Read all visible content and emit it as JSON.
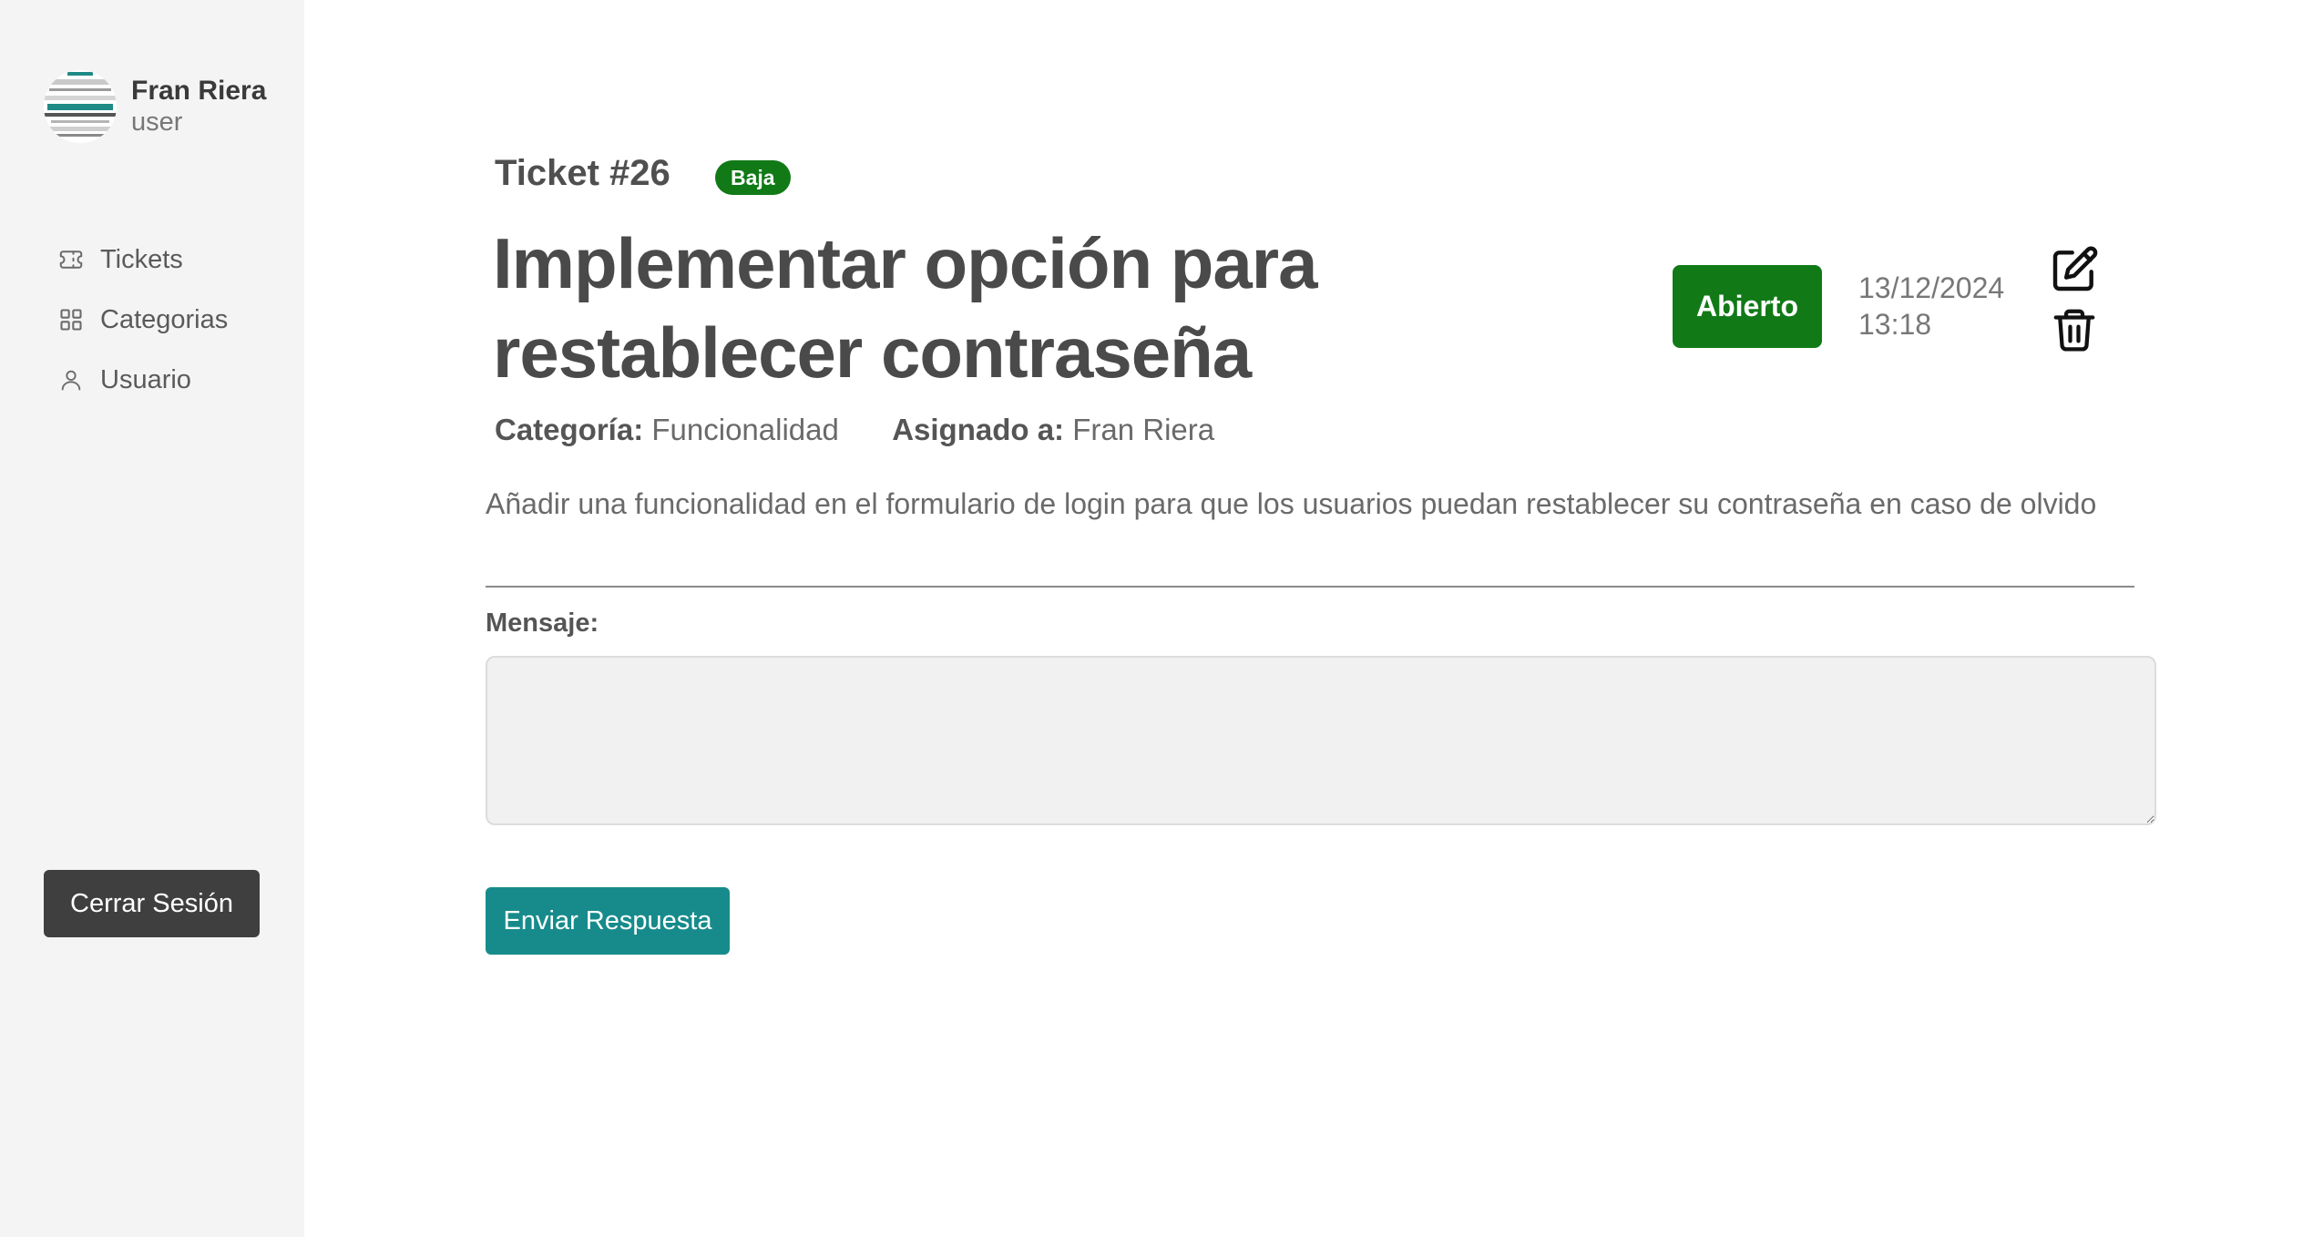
{
  "sidebar": {
    "user": {
      "name": "Fran Riera",
      "role": "user",
      "avatar_icon": "avatar-image"
    },
    "nav": [
      {
        "label": "Tickets",
        "icon": "ticket-icon"
      },
      {
        "label": "Categorias",
        "icon": "grid-icon"
      },
      {
        "label": "Usuario",
        "icon": "user-icon"
      }
    ],
    "logout_label": "Cerrar Sesión"
  },
  "ticket": {
    "number_label": "Ticket #26",
    "priority": "Baja",
    "title": "Implementar opción para restablecer contraseña",
    "status": "Abierto",
    "date": "13/12/2024",
    "time": "13:18",
    "category_label": "Categoría:",
    "category": "Funcionalidad",
    "assigned_label": "Asignado a:",
    "assigned": "Fran Riera",
    "description": "Añadir una funcionalidad en el formulario de login para que los usuarios puedan restablecer su contraseña en caso de olvido",
    "actions": {
      "edit_icon": "edit-icon",
      "delete_icon": "trash-icon"
    }
  },
  "reply": {
    "label": "Mensaje:",
    "value": "",
    "send_label": "Enviar Respuesta"
  },
  "colors": {
    "sidebar_bg": "#f4f4f4",
    "status_green": "#117a17",
    "teal_button": "#178b8b",
    "dark_button": "#3f3f3f"
  }
}
